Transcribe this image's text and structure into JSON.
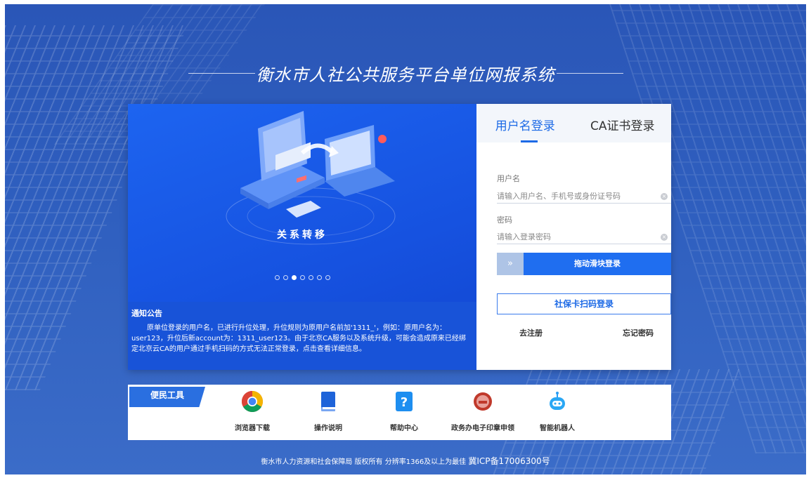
{
  "page": {
    "title": "衡水市人社公共服务平台单位网报系统"
  },
  "banner": {
    "caption": "关系转移",
    "dots_total": 7,
    "dots_active_index": 2
  },
  "notice": {
    "title": "通知公告",
    "body": "原单位登录的用户名，已进行升位处理，升位规则为原用户名前加'1311_'，例如：原用户名为：user123，升位后新account为：1311_user123。由于北京CA服务以及系统升级，可能会造成原来已经绑定北京云CA的用户通过手机扫码的方式无法正常登录，点击查看详细信息。"
  },
  "login": {
    "tabs": [
      {
        "label": "用户名登录",
        "active": true
      },
      {
        "label": "CA证书登录",
        "active": false
      }
    ],
    "username": {
      "label": "用户名",
      "placeholder": "请输入用户名、手机号或身份证号码",
      "value": ""
    },
    "password": {
      "label": "密码",
      "placeholder": "请输入登录密码",
      "value": ""
    },
    "slider": {
      "handle": "»",
      "text": "拖动滑块登录"
    },
    "card_login_button": "社保卡扫码登录",
    "register_link": "去注册",
    "forgot_link": "忘记密码"
  },
  "tools": {
    "badge": "便民工具",
    "items": [
      {
        "label": "浏览器下载",
        "icon": "chrome-icon"
      },
      {
        "label": "操作说明",
        "icon": "book-icon"
      },
      {
        "label": "帮助中心",
        "icon": "help-icon"
      },
      {
        "label": "政务办电子印章申领",
        "icon": "seal-icon"
      },
      {
        "label": "智能机器人",
        "icon": "robot-icon"
      }
    ]
  },
  "footer": {
    "text": "衡水市人力资源和社会保障局  版权所有   分辨率1366及以上为最佳",
    "icp": "冀ICP备17006300号"
  },
  "colors": {
    "primary": "#1d6ae6",
    "banner_blue": "#1652e0",
    "page_blue": "#2f5fbf"
  }
}
